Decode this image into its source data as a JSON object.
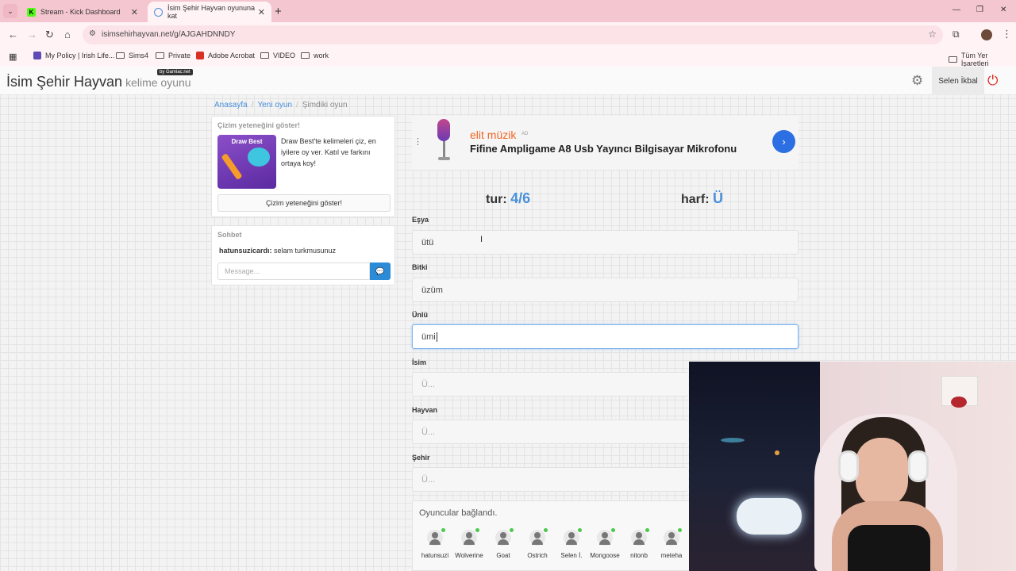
{
  "browser": {
    "tabs": [
      {
        "title": "Stream - Kick Dashboard",
        "favicon": "K"
      },
      {
        "title": "İsim Şehir Hayvan oyununa kat"
      }
    ],
    "url": "isimsehirhayvan.net/g/AJGAHDNNDY",
    "bookmarks": [
      "My Policy | Irish Life...",
      "Sims4",
      "Private",
      "Adobe Acrobat",
      "VIDEO",
      "work"
    ],
    "all_bookmarks": "Tüm Yer İşaretleri"
  },
  "header": {
    "title": "İsim Şehir Hayvan",
    "subtitle": "kelime oyunu",
    "badge": "by Gamiac.net",
    "user": "Selen İkbal"
  },
  "breadcrumb": [
    "Anasayfa",
    "Yeni oyun",
    "Şimdiki oyun"
  ],
  "draw_promo": {
    "heading": "Çizim yeteneğini göster!",
    "thumb_label": "Draw Best",
    "text": "Draw Best'te kelimeleri çiz, en iyilere oy ver. Katıl ve farkını ortaya koy!",
    "button": "Çizim yeteneğini göster!"
  },
  "chat": {
    "heading": "Sohbet",
    "messages": [
      {
        "user": "hatunsuzicardı:",
        "text": "selam turkmusunuz"
      }
    ],
    "placeholder": "Message..."
  },
  "ad": {
    "brand": "elit müzik",
    "tag": "AD",
    "title": "Fifine Ampligame A8 Usb Yayıncı Bilgisayar Mikrofonu"
  },
  "game": {
    "round_label": "tur:",
    "round_value": "4/6",
    "letter_label": "harf:",
    "letter_value": "Ü",
    "fields": [
      {
        "label": "Eşya",
        "value": "ütü"
      },
      {
        "label": "Bitki",
        "value": "üzüm"
      },
      {
        "label": "Ünlü",
        "value": "ümi"
      },
      {
        "label": "İsim",
        "placeholder": "Ü..."
      },
      {
        "label": "Hayvan",
        "placeholder": "Ü..."
      },
      {
        "label": "Şehir",
        "placeholder": "Ü..."
      }
    ]
  },
  "players": {
    "title": "Oyuncular bağlandı.",
    "list": [
      "hatunsuzi",
      "Wolverine",
      "Goat",
      "Ostrich",
      "Selen İ.",
      "Mongoose",
      "nitonb",
      "meteha"
    ]
  },
  "colors": {
    "accent": "#4a90d9",
    "power": "#d9251c",
    "chat_send": "#2b8bd6"
  }
}
